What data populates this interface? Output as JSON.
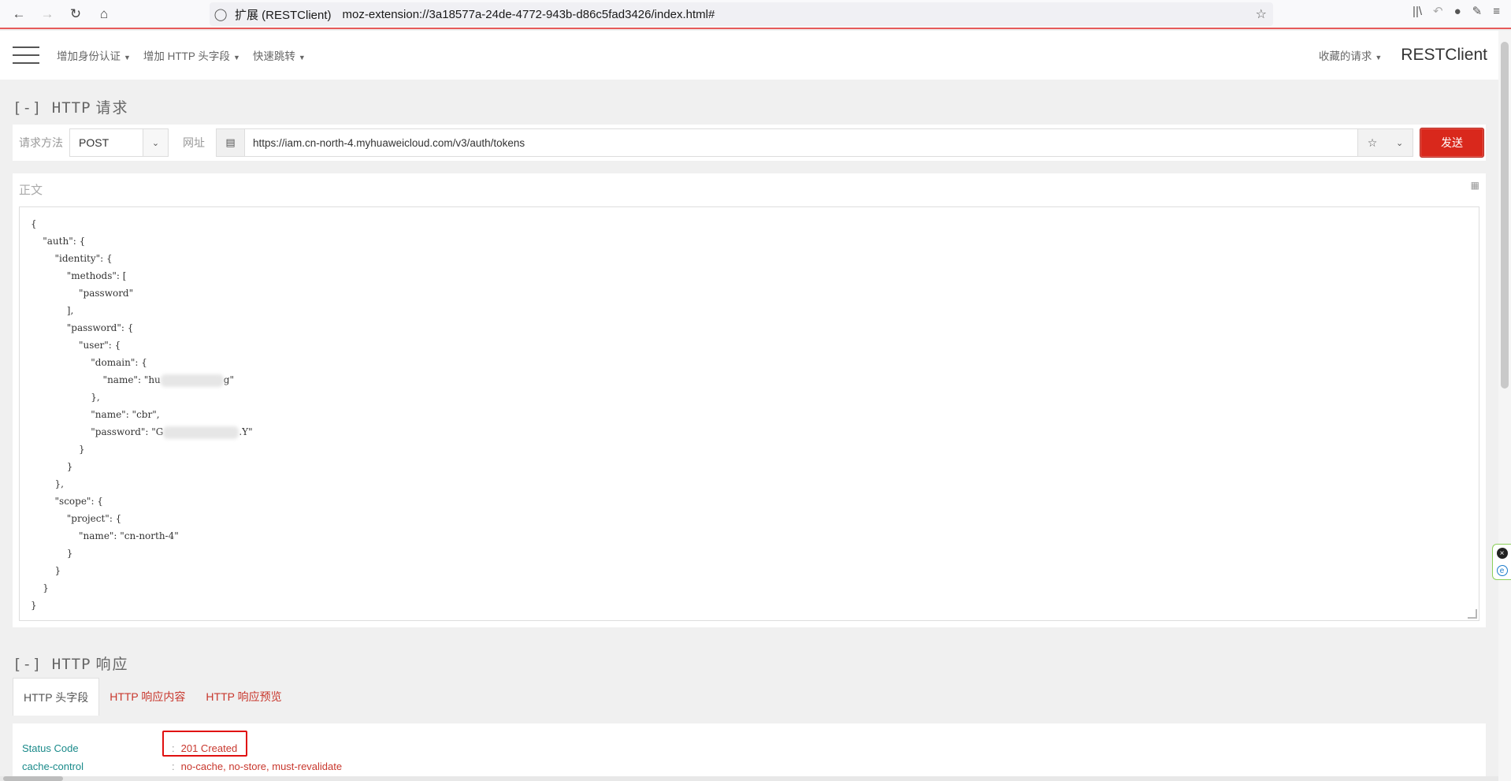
{
  "browser": {
    "ext_label": "扩展 (RESTClient)",
    "url": "moz-extension://3a18577a-24de-4772-943b-d86c5fad3426/index.html#"
  },
  "header": {
    "menu": [
      "增加身份认证",
      "增加 HTTP 头字段",
      "快速跳转"
    ],
    "favorites": "收藏的请求",
    "brand": "RESTClient"
  },
  "request": {
    "section_prefix": "[-] HTTP",
    "section_title": "请求",
    "method_label": "请求方法",
    "method_value": "POST",
    "url_label": "网址",
    "url_value": "https://iam.cn-north-4.myhuaweicloud.com/v3/auth/tokens",
    "send_label": "发送",
    "body_label": "正文",
    "body_lines": [
      "{",
      "    \"auth\": {",
      "        \"identity\": {",
      "            \"methods\": [",
      "                \"password\"",
      "            ],",
      "            \"password\": {",
      "                \"user\": {",
      "                    \"domain\": {",
      "                        \"name\": \"hu",
      "                    },",
      "                    \"name\": \"cbr\",",
      "                    \"password\": \"G",
      "                }",
      "            }",
      "        },",
      "        \"scope\": {",
      "            \"project\": {",
      "                \"name\": \"cn-north-4\"",
      "            }",
      "        }",
      "    }",
      "}"
    ],
    "domain_name_tail": "g\"",
    "password_tail": ".Y\""
  },
  "response": {
    "section_prefix": "[-] HTTP",
    "section_title": "响应",
    "tabs": [
      "HTTP 头字段",
      "HTTP 响应内容",
      "HTTP 响应预览"
    ],
    "headers": [
      {
        "key": "Status Code",
        "value": "201 Created"
      },
      {
        "key": "cache-control",
        "value": "no-cache, no-store, must-revalidate"
      }
    ]
  },
  "colors": {
    "send_button": "#d9281c",
    "header_key": "#1a8a8a",
    "header_value": "#c8372d",
    "highlight_box": "#e01010"
  }
}
